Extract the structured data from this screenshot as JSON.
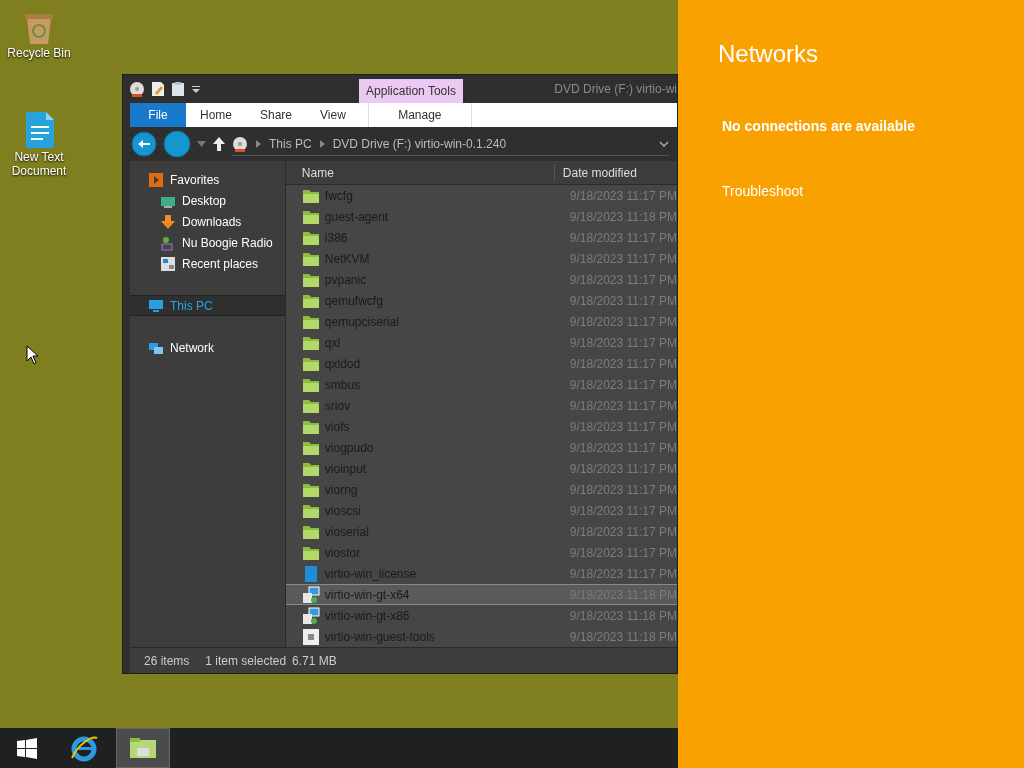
{
  "desktop_icons": [
    {
      "label": "Recycle Bin",
      "kind": "recycle"
    },
    {
      "label": "New Text Document",
      "kind": "text"
    }
  ],
  "explorer": {
    "title": "DVD Drive (F:) virtio-wi",
    "context_group": "Application Tools",
    "ribbon_tabs": [
      {
        "label": "File",
        "kind": "file",
        "selected": false
      },
      {
        "label": "Home",
        "kind": "plain",
        "selected": false
      },
      {
        "label": "Share",
        "kind": "plain",
        "selected": false
      },
      {
        "label": "View",
        "kind": "plain",
        "selected": false
      },
      {
        "label": "Manage",
        "kind": "context",
        "selected": false
      }
    ],
    "breadcrumb": [
      "This PC",
      "DVD Drive (F:) virtio-win-0.1.240"
    ],
    "nav": [
      {
        "label": "Favorites",
        "kind": "favorites",
        "selected": false,
        "children": [
          {
            "label": "Desktop",
            "kind": "desktop",
            "selected": false
          },
          {
            "label": "Downloads",
            "kind": "downloads",
            "selected": false
          },
          {
            "label": "Nu Boogie Radio",
            "kind": "radio",
            "selected": false
          },
          {
            "label": "Recent places",
            "kind": "recent",
            "selected": false
          }
        ]
      },
      {
        "label": "This PC",
        "kind": "pc",
        "selected": true
      },
      {
        "label": "Network",
        "kind": "network",
        "selected": false
      }
    ],
    "columns": [
      "Name",
      "Date modified"
    ],
    "files": [
      {
        "name": "fwcfg",
        "date": "9/18/2023 11:17 PM",
        "kind": "folder",
        "selected": false
      },
      {
        "name": "guest-agent",
        "date": "9/18/2023 11:18 PM",
        "kind": "folder",
        "selected": false
      },
      {
        "name": "i386",
        "date": "9/18/2023 11:17 PM",
        "kind": "folder",
        "selected": false
      },
      {
        "name": "NetKVM",
        "date": "9/18/2023 11:17 PM",
        "kind": "folder",
        "selected": false
      },
      {
        "name": "pvpanic",
        "date": "9/18/2023 11:17 PM",
        "kind": "folder",
        "selected": false
      },
      {
        "name": "qemufwcfg",
        "date": "9/18/2023 11:17 PM",
        "kind": "folder",
        "selected": false
      },
      {
        "name": "qemupciserial",
        "date": "9/18/2023 11:17 PM",
        "kind": "folder",
        "selected": false
      },
      {
        "name": "qxl",
        "date": "9/18/2023 11:17 PM",
        "kind": "folder",
        "selected": false
      },
      {
        "name": "qxldod",
        "date": "9/18/2023 11:17 PM",
        "kind": "folder",
        "selected": false
      },
      {
        "name": "smbus",
        "date": "9/18/2023 11:17 PM",
        "kind": "folder",
        "selected": false
      },
      {
        "name": "sriov",
        "date": "9/18/2023 11:17 PM",
        "kind": "folder",
        "selected": false
      },
      {
        "name": "viofs",
        "date": "9/18/2023 11:17 PM",
        "kind": "folder",
        "selected": false
      },
      {
        "name": "viogpudo",
        "date": "9/18/2023 11:17 PM",
        "kind": "folder",
        "selected": false
      },
      {
        "name": "vioinput",
        "date": "9/18/2023 11:17 PM",
        "kind": "folder",
        "selected": false
      },
      {
        "name": "viorng",
        "date": "9/18/2023 11:17 PM",
        "kind": "folder",
        "selected": false
      },
      {
        "name": "vioscsi",
        "date": "9/18/2023 11:17 PM",
        "kind": "folder",
        "selected": false
      },
      {
        "name": "vioserial",
        "date": "9/18/2023 11:17 PM",
        "kind": "folder",
        "selected": false
      },
      {
        "name": "viostor",
        "date": "9/18/2023 11:17 PM",
        "kind": "folder",
        "selected": false
      },
      {
        "name": "virtio-win_license",
        "date": "9/18/2023 11:17 PM",
        "kind": "document",
        "selected": false
      },
      {
        "name": "virtio-win-gt-x64",
        "date": "9/18/2023 11:18 PM",
        "kind": "installer",
        "selected": true
      },
      {
        "name": "virtio-win-gt-x86",
        "date": "9/18/2023 11:18 PM",
        "kind": "installer",
        "selected": false
      },
      {
        "name": "virtio-win-guest-tools",
        "date": "9/18/2023 11:18 PM",
        "kind": "setup",
        "selected": false
      }
    ],
    "status": {
      "count": "26 items",
      "selection": "1 item selected",
      "size": "6.71 MB"
    }
  },
  "networks_panel": {
    "title": "Networks",
    "message": "No connections are available",
    "link": "Troubleshoot"
  },
  "taskbar": [
    {
      "kind": "start",
      "selected": false
    },
    {
      "kind": "browser",
      "selected": false
    },
    {
      "kind": "explorer",
      "selected": true
    }
  ]
}
